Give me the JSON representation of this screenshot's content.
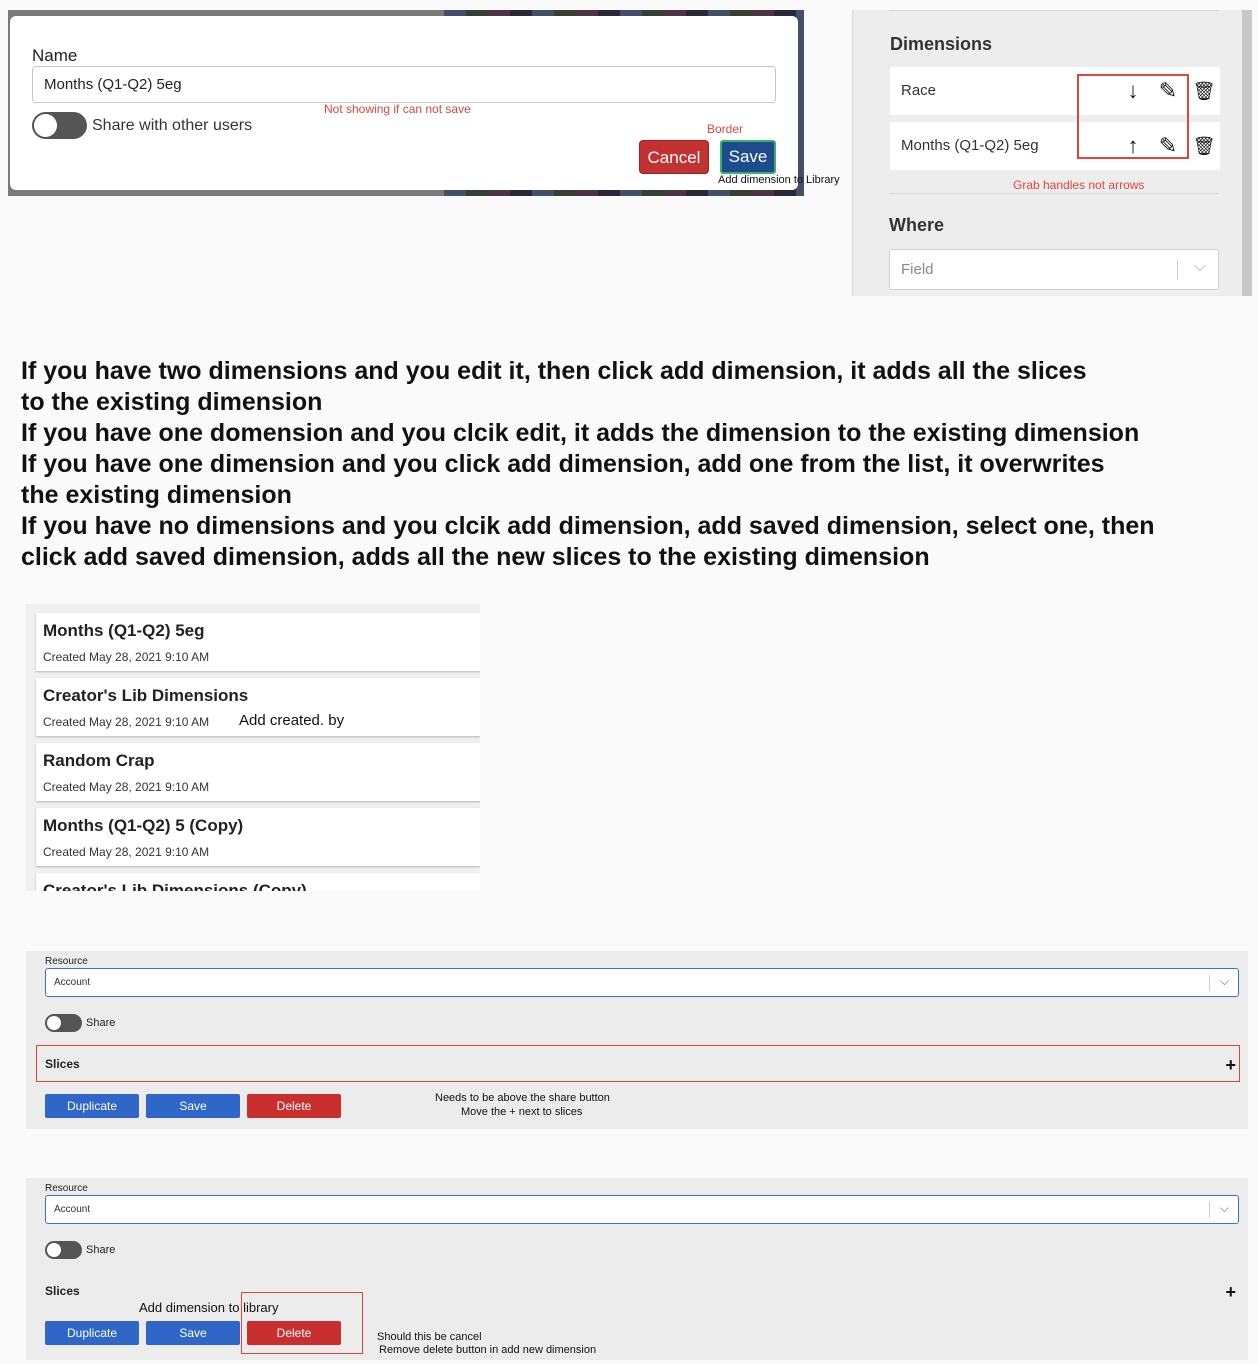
{
  "modal": {
    "name_label": "Name",
    "name_value": "Months (Q1-Q2) 5eg",
    "note_not_showing": "Not showing if can not save",
    "share_label": "Share with other users",
    "note_border": "Border",
    "cancel_label": "Cancel",
    "save_label": "Save",
    "note_add_library": "Add dimension to Library"
  },
  "dimensions_panel": {
    "title": "Dimensions",
    "rows": [
      {
        "label": "Race",
        "arrow": "↓"
      },
      {
        "label": "Months (Q1-Q2) 5eg",
        "arrow": "↑"
      }
    ],
    "edit_glyph": "✎",
    "delete_glyph": "🗑",
    "note_grab": "Grab handles not arrows",
    "where_title": "Where",
    "where_placeholder": "Field",
    "chevron": "⌵"
  },
  "notes": [
    "If you have two dimensions and you edit it, then click add dimension, it adds all the slices\nto the existing dimension",
    "If you have one domension and you clcik edit, it adds the dimension to the existing dimension",
    "If you have one dimension and you click add dimension, add one from the list, it overwrites\nthe existing dimension",
    "If you have no dimensions and you clcik add dimension, add saved dimension, select one, then\nclick add saved dimension, adds all the new slices to the existing dimension"
  ],
  "saved_list": {
    "items": [
      {
        "title": "Months (Q1-Q2) 5eg",
        "date": "Created May 28, 2021 9:10 AM",
        "note": ""
      },
      {
        "title": "Creator's Lib Dimensions",
        "date": "Created May 28, 2021 9:10 AM",
        "note": "Add created. by"
      },
      {
        "title": "Random Crap",
        "date": "Created May 28, 2021 9:10 AM",
        "note": ""
      },
      {
        "title": "Months (Q1-Q2) 5 (Copy)",
        "date": "Created May 28, 2021 9:10 AM",
        "note": ""
      },
      {
        "title": "Creator's Lib Dimensions (Copy)",
        "date": "",
        "note": ""
      }
    ]
  },
  "resource_panel_1": {
    "resource_label": "Resource",
    "resource_value": "Account",
    "share_label": "Share",
    "slices_label": "Slices",
    "plus": "+",
    "duplicate_label": "Duplicate",
    "save_label": "Save",
    "delete_label": "Delete",
    "note_line1": "Needs to be above the share button",
    "note_line2": "Move the + next to slices"
  },
  "resource_panel_2": {
    "resource_label": "Resource",
    "resource_value": "Account",
    "share_label": "Share",
    "slices_label": "Slices",
    "plus": "+",
    "duplicate_label": "Duplicate",
    "save_label": "Save",
    "delete_label": "Delete",
    "note_add_library": "Add dimension to library",
    "note_line1": "Should this be cancel",
    "note_line2": "Remove delete button in add new dimension"
  },
  "colors": {
    "annotation_red": "#e0453a",
    "primary_blue": "#2f66c8",
    "danger_red": "#c92f2f"
  }
}
